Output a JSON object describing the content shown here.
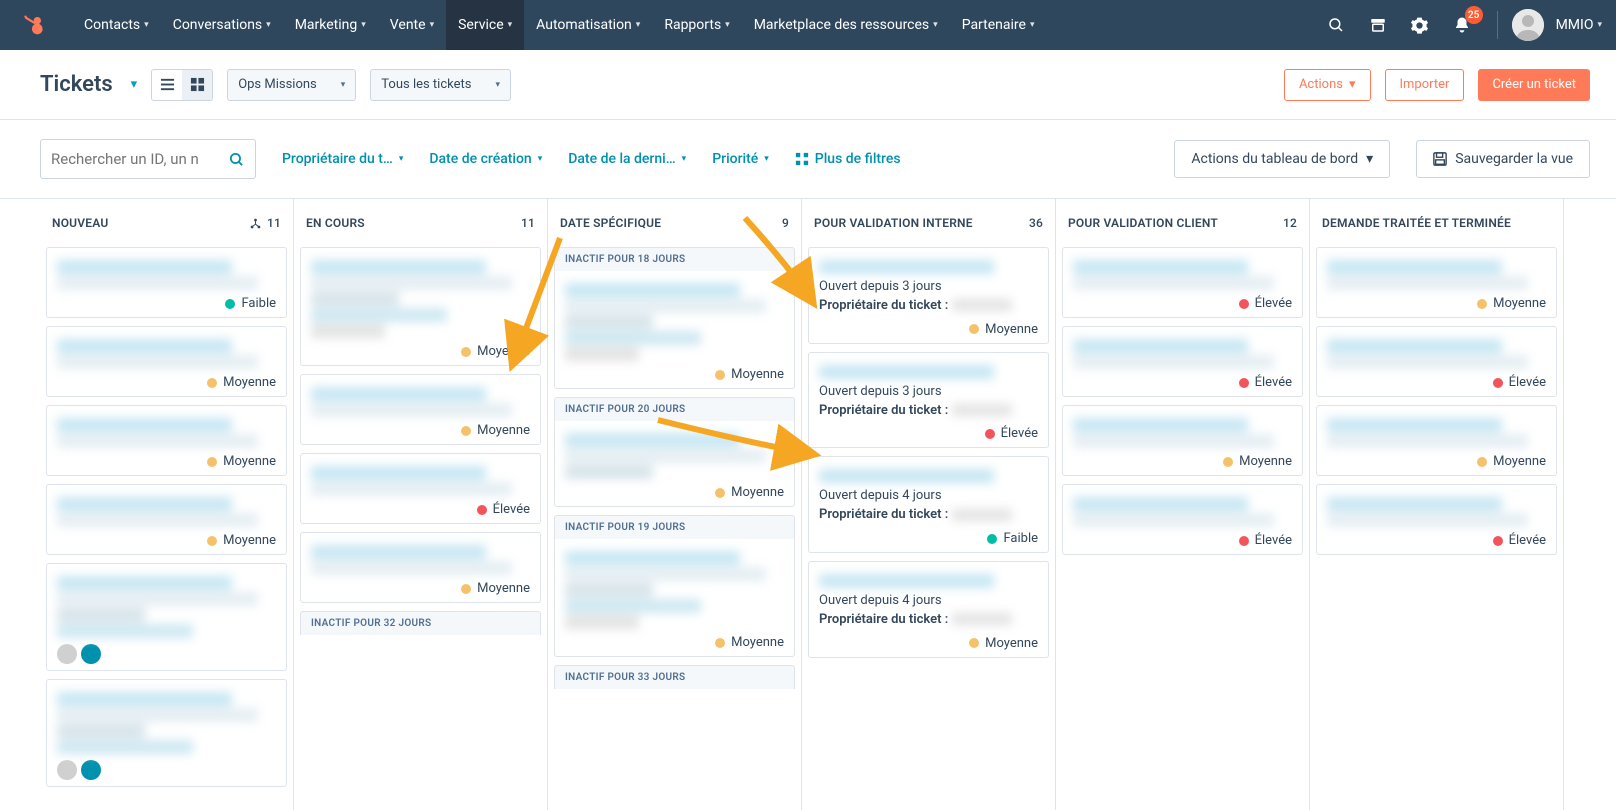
{
  "nav": {
    "items": [
      "Contacts",
      "Conversations",
      "Marketing",
      "Vente",
      "Service",
      "Automatisation",
      "Rapports",
      "Marketplace des ressources",
      "Partenaire"
    ],
    "active_index": 4,
    "notif_count": "25",
    "account_label": "MMIO"
  },
  "toolbar": {
    "title": "Tickets",
    "pipeline_select": "Ops Missions",
    "filter_select": "Tous les tickets",
    "actions_label": "Actions",
    "import_label": "Importer",
    "create_label": "Créer un ticket"
  },
  "filters": {
    "search_placeholder": "Rechercher un ID, un n",
    "chips": [
      "Propriétaire du t…",
      "Date de création",
      "Date de la derni…",
      "Priorité"
    ],
    "more_label": "Plus de filtres",
    "board_actions": "Actions du tableau de bord",
    "save_view": "Sauvegarder la vue"
  },
  "priority_labels": {
    "low": "Faible",
    "med": "Moyenne",
    "hi": "Élevée"
  },
  "columns": [
    {
      "id": "nouveau",
      "title": "NOUVEAU",
      "count": "11",
      "tree_icon": true,
      "cards": [
        {
          "priority": "low"
        },
        {
          "priority": "med"
        },
        {
          "priority": "med"
        },
        {
          "priority": "med"
        },
        {
          "avatars": 2
        },
        {
          "avatars": 2
        }
      ]
    },
    {
      "id": "encours",
      "title": "EN COURS",
      "count": "11",
      "cards": [
        {
          "tall": true,
          "priority": "med"
        },
        {
          "priority": "med"
        },
        {
          "priority": "hi"
        },
        {
          "priority": "med"
        },
        {
          "inactive_label": "INACTIF POUR 32 JOURS"
        }
      ]
    },
    {
      "id": "date",
      "title": "DATE SPÉCIFIQUE",
      "count": "9",
      "cards": [
        {
          "inactive_label": "INACTIF POUR 18 JOURS",
          "tall": true,
          "priority": "med"
        },
        {
          "inactive_label": "INACTIF POUR 20 JOURS",
          "priority": "med"
        },
        {
          "inactive_label": "INACTIF POUR 19 JOURS",
          "tall": true,
          "priority": "med"
        },
        {
          "inactive_label": "INACTIF POUR 33 JOURS"
        }
      ]
    },
    {
      "id": "val_int",
      "title": "POUR VALIDATION INTERNE",
      "count": "36",
      "cards": [
        {
          "meta_open": "Ouvert depuis 3 jours",
          "meta_owner": "Propriétaire du ticket :",
          "priority": "med"
        },
        {
          "meta_open": "Ouvert depuis 3 jours",
          "meta_owner": "Propriétaire du ticket :",
          "priority": "hi"
        },
        {
          "meta_open": "Ouvert depuis 4 jours",
          "meta_owner": "Propriétaire du ticket :",
          "priority": "low"
        },
        {
          "meta_open": "Ouvert depuis 4 jours",
          "meta_owner": "Propriétaire du ticket :",
          "priority": "med"
        }
      ]
    },
    {
      "id": "val_cli",
      "title": "POUR VALIDATION CLIENT",
      "count": "12",
      "cards": [
        {
          "priority": "hi"
        },
        {
          "priority": "hi"
        },
        {
          "priority": "med"
        },
        {
          "priority": "hi"
        }
      ]
    },
    {
      "id": "done",
      "title": "DEMANDE TRAITÉE ET TERMINÉE",
      "count": "",
      "cards": [
        {
          "priority": "med",
          "cut": true
        },
        {
          "priority": "hi",
          "cut": true
        },
        {
          "priority": "med",
          "cut": true
        },
        {
          "priority": "hi",
          "cut": true
        }
      ]
    }
  ]
}
